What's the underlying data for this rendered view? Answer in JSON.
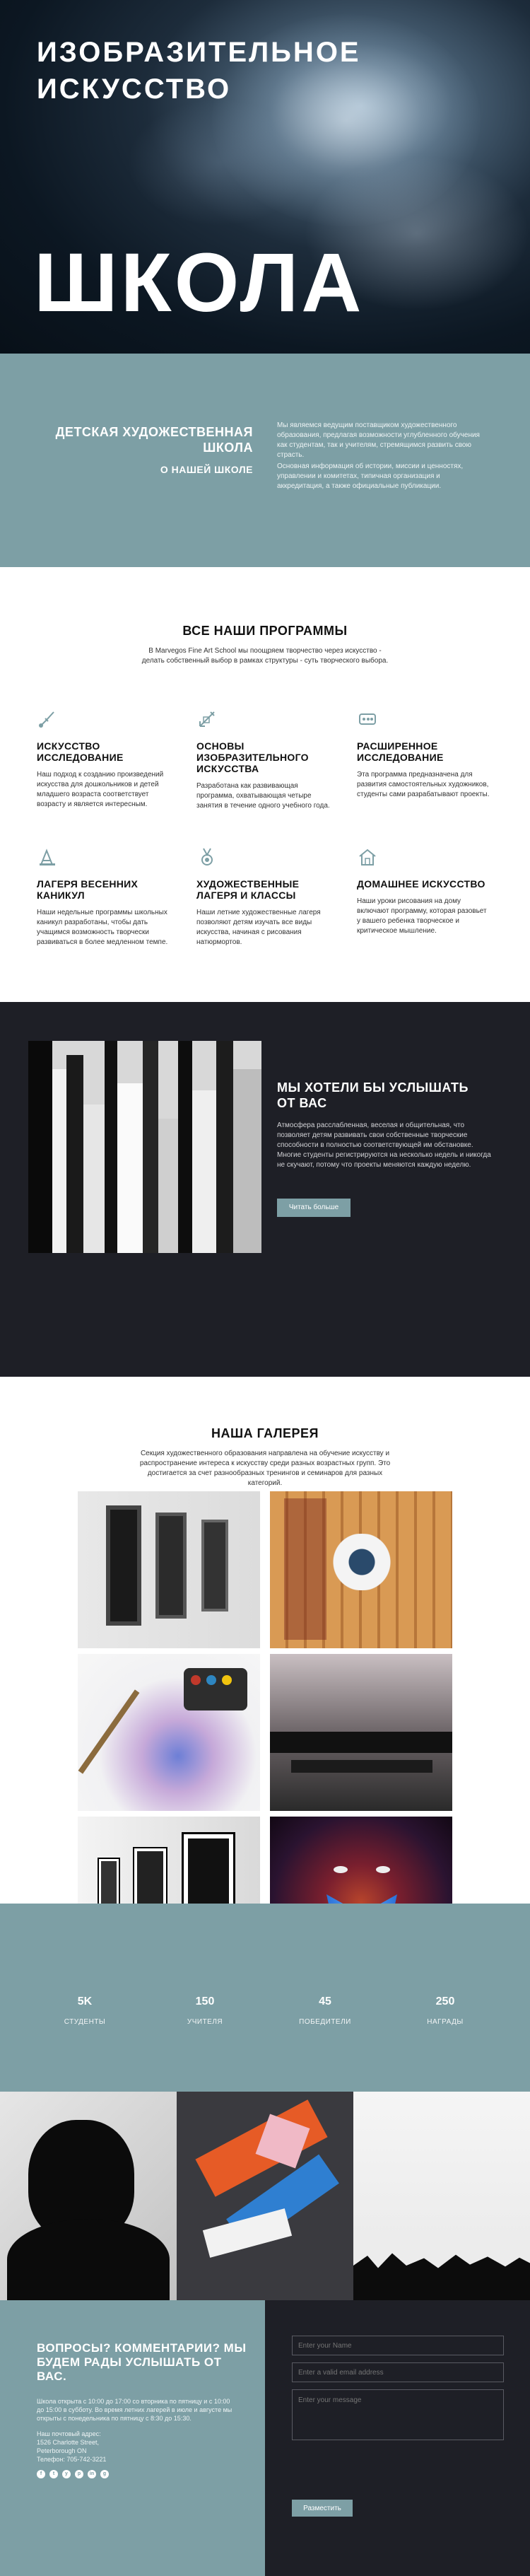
{
  "hero": {
    "title": "ИЗОБРАЗИТЕЛЬНОЕ ИСКУССТВО",
    "big": "ШКОЛА"
  },
  "about": {
    "heading": "ДЕТСКАЯ ХУДОЖЕСТВЕННАЯ ШКОЛА",
    "subheading": "О НАШЕЙ ШКОЛЕ",
    "text1": "Мы являемся ведущим поставщиком художественного образования, предлагая возможности углубленного обучения как студентам, так и учителям, стремящимся развить свою страсть.",
    "text2": "Основная информация об истории, миссии и ценностях, управлении и комитетах, типичная организация и аккредитация, а также официальные публикации."
  },
  "programs": {
    "title": "ВСЕ НАШИ ПРОГРАММЫ",
    "subtitle": "В Marvegos Fine Art School мы поощряем творчество через искусство - делать собственный выбор в рамках структуры - суть творческого выбора.",
    "items": [
      {
        "icon": "brush-icon",
        "title": "ИСКУССТВО ИССЛЕДОВАНИЕ",
        "text": "Наш подход к созданию произведений искусства для дошкольников и детей младшего возраста соответствует возрасту и является интересным."
      },
      {
        "icon": "pencil-icon",
        "title": "ОСНОВЫ ИЗОБРАЗИТЕЛЬНОГО ИСКУССТВА",
        "text": "Разработана как развивающая программа, охватывающая четыре занятия в течение одного учебного года."
      },
      {
        "icon": "palette-icon",
        "title": "РАСШИРЕННОЕ ИССЛЕДОВАНИЕ",
        "text": "Эта программа предназначена для развития самостоятельных художников, студенты сами разрабатывают проекты."
      },
      {
        "icon": "easel-icon",
        "title": "ЛАГЕРЯ ВЕСЕННИХ КАНИКУЛ",
        "text": "Наши недельные программы школьных каникул разработаны, чтобы дать учащимся возможность творчески развиваться в более медленном темпе."
      },
      {
        "icon": "medal-icon",
        "title": "ХУДОЖЕСТВЕННЫЕ ЛАГЕРЯ И КЛАССЫ",
        "text": "Наши летние художественные лагеря позволяют детям изучать все виды искусства, начиная с рисования натюрмортов."
      },
      {
        "icon": "house-icon",
        "title": "ДОМАШНЕЕ ИСКУССТВО",
        "text": "Наши уроки рисования на дому включают программу, которая разовьет у вашего ребенка творческое и критическое мышление."
      }
    ]
  },
  "feedback": {
    "title": "МЫ ХОТЕЛИ БЫ УСЛЫШАТЬ ОТ ВАС",
    "text": "Атмосфера расслабленная, веселая и общительная, что позволяет детям развивать свои собственные творческие способности в полностью соответствующей им обстановке. Многие студенты регистрируются на несколько недель и никогда не скучают, потому что проекты меняются каждую неделю.",
    "button": "Читать больше"
  },
  "gallery": {
    "title": "НАША ГАЛЕРЕЯ",
    "subtitle": "Секция художественного образования направлена на обучение искусству и распространение интереса к искусству среди разных возрастных групп. Это достигается за счет разнообразных тренингов и семинаров для разных категорий."
  },
  "stats": [
    {
      "num": "5K",
      "label": "СТУДЕНТЫ"
    },
    {
      "num": "150",
      "label": "УЧИТЕЛЯ"
    },
    {
      "num": "45",
      "label": "ПОБЕДИТЕЛИ"
    },
    {
      "num": "250",
      "label": "НАГРАДЫ"
    }
  ],
  "contact": {
    "title": "ВОПРОСЫ? КОММЕНТАРИИ? МЫ БУДЕМ РАДЫ УСЛЫШАТЬ ОТ ВАС.",
    "hours": "Школа открыта с 10:00 до 17:00 со вторника по пятницу и с 10:00 до 15:00 в субботу. Во время летних лагерей в июле и августе мы открыты с понедельника по пятницу с 8:30 до 15:30.",
    "address_label": "Наш почтовый адрес:",
    "address1": "1526 Charlotte Street,",
    "address2": "Peterborough ON",
    "phone": "Телефон: 705-742-3221",
    "socials": [
      "f",
      "t",
      "y",
      "p",
      "in",
      "g"
    ],
    "name_placeholder": "Enter your Name",
    "email_placeholder": "Enter a valid email address",
    "message_placeholder": "Enter your message",
    "submit": "Разместить"
  },
  "colors": {
    "accent": "#7d9fa5",
    "dark": "#1e1f26"
  }
}
